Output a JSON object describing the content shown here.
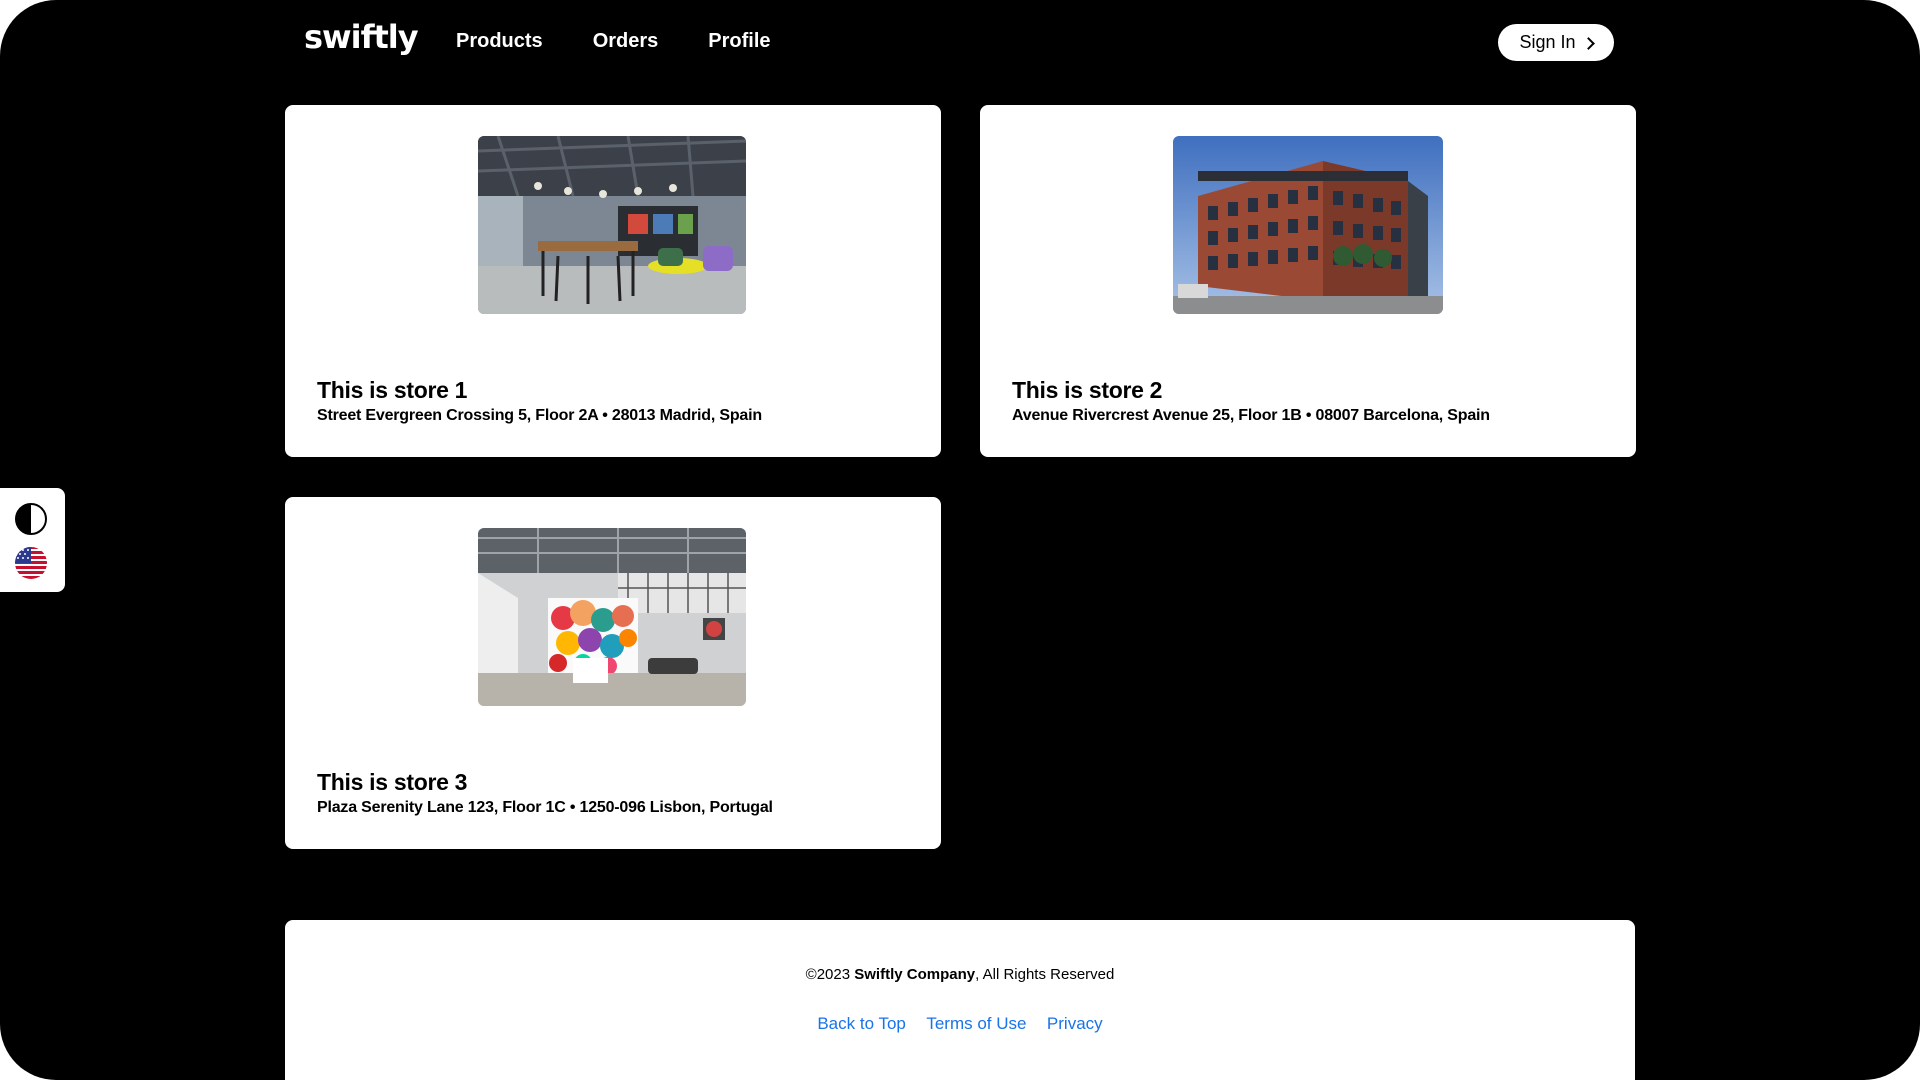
{
  "header": {
    "logo": "swiftly",
    "nav": [
      {
        "label": "Products"
      },
      {
        "label": "Orders"
      },
      {
        "label": "Profile"
      }
    ],
    "signin_label": "Sign In",
    "signin_icon": "chevron-right-icon"
  },
  "stores": [
    {
      "title": "This is store 1",
      "address": "Street Evergreen Crossing 5, Floor 2A • 28013 Madrid, Spain",
      "image": "office-interior-photo"
    },
    {
      "title": "This is store 2",
      "address": "Avenue Rivercrest Avenue 25, Floor 1B • 08007 Barcelona, Spain",
      "image": "brick-office-building-photo"
    },
    {
      "title": "This is store 3",
      "address": "Plaza Serenity Lane 123, Floor 1C • 1250-096 Lisbon, Portugal",
      "image": "atrium-mural-photo"
    }
  ],
  "side_panel": {
    "contrast_icon": "contrast-toggle-icon",
    "language_icon": "us-flag-icon"
  },
  "footer": {
    "copyright_prefix": "©2023 ",
    "company": "Swiftly Company",
    "copyright_suffix": ", All Rights Reserved",
    "links": [
      {
        "label": "Back to Top"
      },
      {
        "label": "Terms of Use"
      },
      {
        "label": "Privacy"
      }
    ]
  },
  "colors": {
    "background": "#000000",
    "card": "#ffffff",
    "link": "#1a73e8"
  }
}
